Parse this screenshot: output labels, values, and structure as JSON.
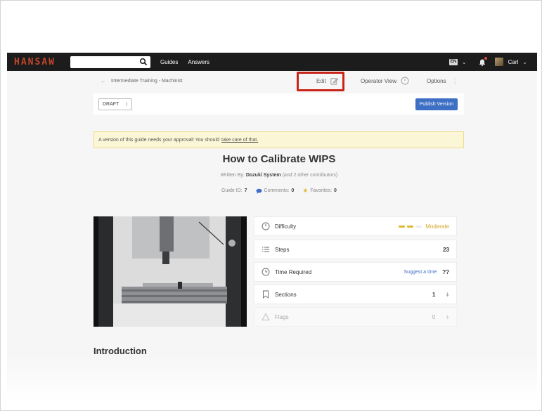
{
  "nav": {
    "logo": "HANSAW",
    "search_placeholder": "",
    "links": [
      "Guides",
      "Answers"
    ],
    "lang": "EN",
    "username": "Carl"
  },
  "toolbar": {
    "breadcrumb": "Intermediate Training - Machinist",
    "edit_label": "Edit",
    "operator_view_label": "Operator View",
    "options_label": "Options"
  },
  "draft": {
    "status": "DRAFT",
    "publish_label": "Publish Version"
  },
  "alert": {
    "text": "A version of this guide needs your approval! You should",
    "link": "take care of that."
  },
  "guide": {
    "title": "How to Calibrate WIPS",
    "written_by_label": "Written By:",
    "author": "Dozuki System",
    "contributors": "(and 2 other contributors)",
    "guide_id_label": "Guide ID:",
    "guide_id": "7",
    "comments_label": "Comments:",
    "comments": "0",
    "favorites_label": "Favorites:",
    "favorites": "0"
  },
  "details": {
    "difficulty_label": "Difficulty",
    "difficulty_value": "Moderate",
    "difficulty_level": 2,
    "difficulty_max": 3,
    "steps_label": "Steps",
    "steps_value": "23",
    "time_label": "Time Required",
    "time_suggest": "Suggest a time",
    "time_value": "??",
    "sections_label": "Sections",
    "sections_value": "1",
    "flags_label": "Flags",
    "flags_value": "0"
  },
  "intro_heading": "Introduction",
  "colors": {
    "nav_bg": "#1c1c1c",
    "logo": "#c4462a",
    "publish": "#3d6fc4",
    "highlight": "#c92417",
    "difficulty": "#e0b82c"
  }
}
